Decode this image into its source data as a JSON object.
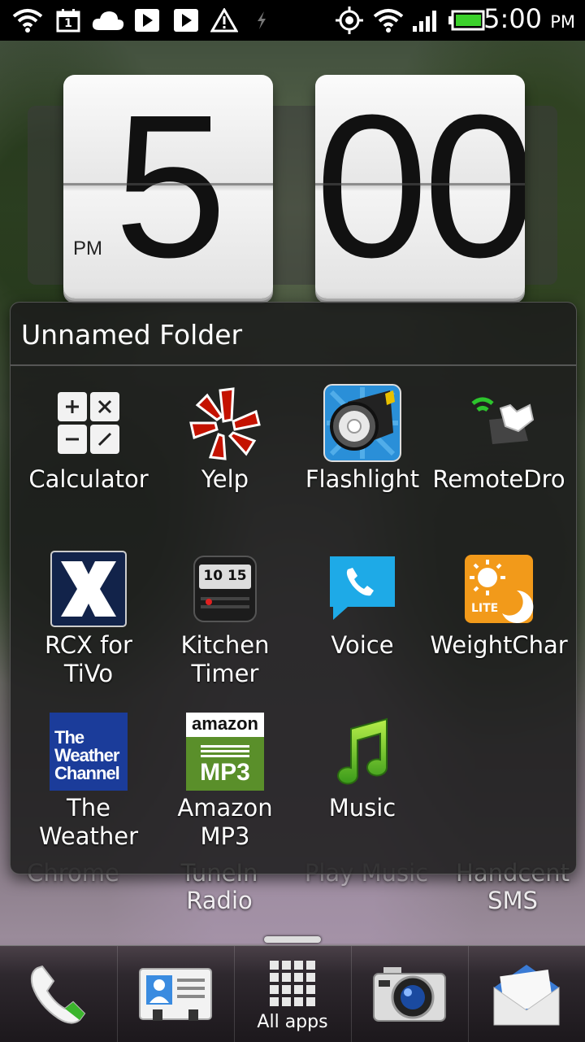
{
  "status_bar": {
    "time": "5:00",
    "ampm": "PM",
    "icons": [
      "wifi-icon",
      "calendar-icon",
      "cloud-icon",
      "play-store-icon",
      "play-store-icon",
      "alert-icon",
      "usb-icon",
      "gps-icon",
      "wifi-icon",
      "signal-icon",
      "battery-icon"
    ],
    "calendar_day": "1"
  },
  "clock_widget": {
    "hour": "5",
    "minutes": "00",
    "ampm": "PM"
  },
  "folder": {
    "title": "Unnamed Folder",
    "apps": [
      {
        "label": "Calculator",
        "icon": "calculator-icon"
      },
      {
        "label": "Yelp",
        "icon": "yelp-icon"
      },
      {
        "label": "Flashlight",
        "icon": "flashlight-icon"
      },
      {
        "label": "RemoteDro",
        "icon": "remotedroid-icon"
      },
      {
        "label": "RCX for\nTiVo",
        "icon": "rcx-tivo-icon"
      },
      {
        "label": "Kitchen\nTimer",
        "icon": "kitchen-timer-icon",
        "display": "10 15"
      },
      {
        "label": "Voice",
        "icon": "voice-icon"
      },
      {
        "label": "WeightChar",
        "icon": "weightchart-icon",
        "badge": "LITE"
      },
      {
        "label": "The\nWeather",
        "icon": "weather-channel-icon",
        "logo_text": "The\nWeather\nChannel"
      },
      {
        "label": "Amazon\nMP3",
        "icon": "amazon-mp3-icon",
        "logo_top": "amazon",
        "logo_bottom": "MP3"
      },
      {
        "label": "Music",
        "icon": "music-icon"
      }
    ]
  },
  "home_screen": {
    "bottom_labels": [
      "Chrome",
      "TuneIn\nRadio",
      "Play Music",
      "Handcent\nSMS"
    ]
  },
  "dock": {
    "all_apps_label": "All apps",
    "items": [
      "phone-icon",
      "contacts-icon",
      "all-apps-icon",
      "camera-icon",
      "mail-icon"
    ]
  },
  "colors": {
    "folder_bg": "#1c1c1c",
    "status_bar_bg": "#000000",
    "battery_green": "#3bd12b"
  }
}
